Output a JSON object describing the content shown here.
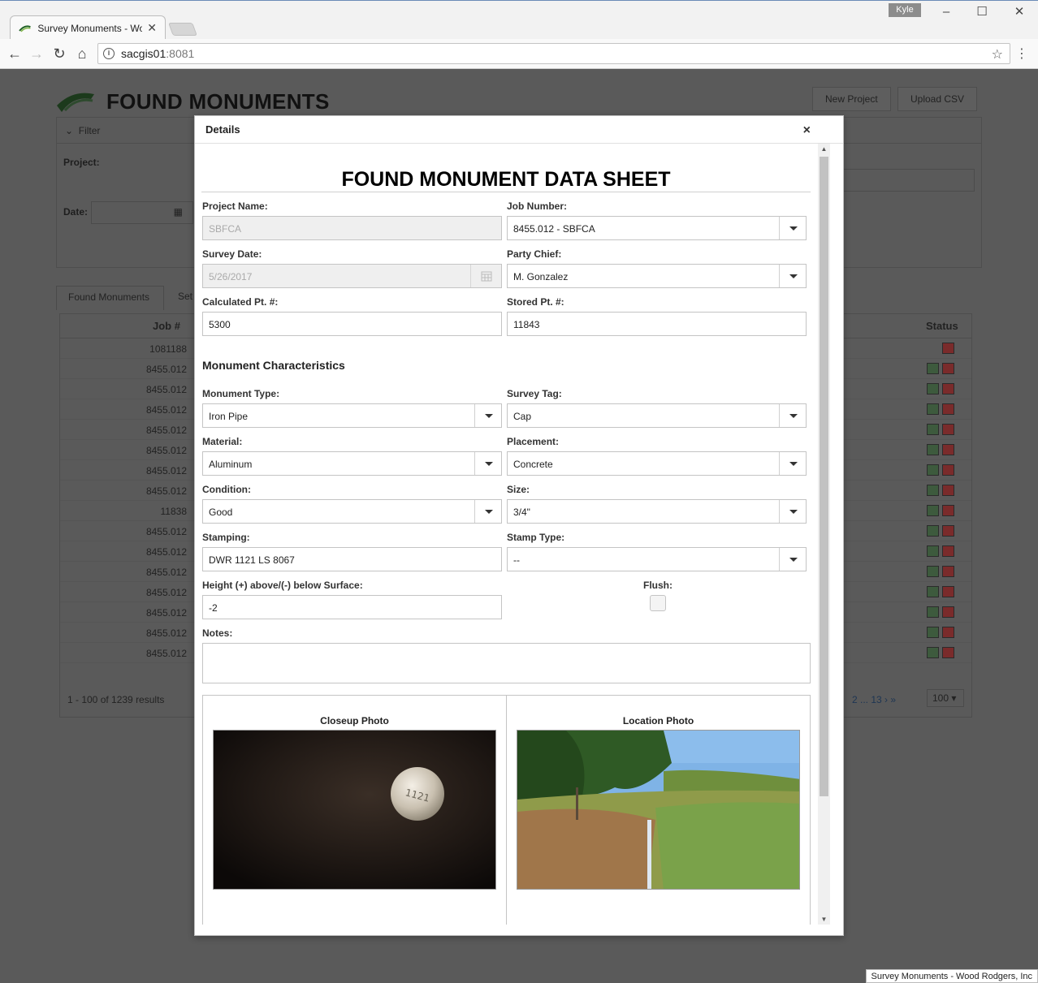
{
  "browser": {
    "tab_title": "Survey Monuments - Wo",
    "url_host": "sacgis01",
    "url_port": ":8081",
    "user_badge": "Kyle"
  },
  "app": {
    "title": "FOUND MONUMENTS",
    "new_project_label": "New Project",
    "upload_csv_label": "Upload CSV",
    "filter_label": "Filter",
    "project_label": "Project:",
    "date_label": "Date:",
    "tabs": [
      "Found Monuments",
      "Set"
    ],
    "grid_headers": {
      "job": "Job #",
      "status": "Status"
    },
    "rows": [
      {
        "job": "1081188",
        "qc": "r"
      },
      {
        "job": "8455.012",
        "qc": "g"
      },
      {
        "job": "8455.012",
        "qc": "g"
      },
      {
        "job": "8455.012",
        "qc": "g"
      },
      {
        "job": "8455.012",
        "qc": "g"
      },
      {
        "job": "8455.012",
        "qc": "g"
      },
      {
        "job": "8455.012",
        "qc": "g"
      },
      {
        "job": "8455.012",
        "qc": "g"
      },
      {
        "job": "11838",
        "qc": "g"
      },
      {
        "job": "8455.012",
        "qc": "g"
      },
      {
        "job": "8455.012",
        "qc": "g"
      },
      {
        "job": "8455.012",
        "qc": "g"
      },
      {
        "job": "8455.012",
        "qc": "g"
      },
      {
        "job": "8455.012",
        "qc": "g"
      },
      {
        "job": "8455.012",
        "qc": "g"
      },
      {
        "job": "8455.012",
        "qc": "g"
      }
    ],
    "result_count": "1 - 100 of 1239 results",
    "pages": "2 ... 13 › »",
    "page_size": "100 ▾",
    "status_bar": "Survey Monuments - Wood Rodgers, Inc"
  },
  "modal": {
    "title": "Details",
    "close": "×",
    "sheet_title": "FOUND MONUMENT DATA SHEET",
    "project_name": {
      "label": "Project Name:",
      "value": "SBFCA"
    },
    "job_number": {
      "label": "Job Number:",
      "value": "8455.012 - SBFCA"
    },
    "survey_date": {
      "label": "Survey Date:",
      "value": "5/26/2017"
    },
    "party_chief": {
      "label": "Party Chief:",
      "value": "M. Gonzalez"
    },
    "calc_pt": {
      "label": "Calculated Pt. #:",
      "value": "5300"
    },
    "stored_pt": {
      "label": "Stored Pt. #:",
      "value": "11843"
    },
    "section_title": "Monument Characteristics",
    "monument_type": {
      "label": "Monument Type:",
      "value": "Iron Pipe"
    },
    "survey_tag": {
      "label": "Survey Tag:",
      "value": "Cap"
    },
    "material": {
      "label": "Material:",
      "value": "Aluminum"
    },
    "placement": {
      "label": "Placement:",
      "value": "Concrete"
    },
    "condition": {
      "label": "Condition:",
      "value": "Good"
    },
    "size": {
      "label": "Size:",
      "value": "3/4\""
    },
    "stamping": {
      "label": "Stamping:",
      "value": "DWR 1121 LS 8067"
    },
    "stamp_type": {
      "label": "Stamp Type:",
      "value": "--"
    },
    "height": {
      "label": "Height (+) above/(-) below Surface:",
      "value": "-2"
    },
    "flush": {
      "label": "Flush:"
    },
    "notes": {
      "label": "Notes:"
    },
    "closeup_photo": "Closeup Photo",
    "location_photo": "Location Photo",
    "closeup_stamp": "1121"
  }
}
